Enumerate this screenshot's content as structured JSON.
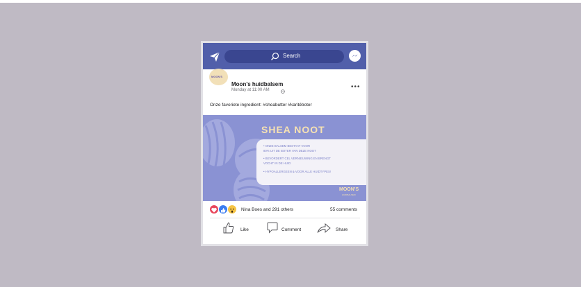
{
  "search": {
    "placeholder": "Search"
  },
  "post": {
    "avatar_text": "MOON'S",
    "page_name": "Moon's huidbalsem",
    "time": "Monday at 11:00 AM",
    "text": "Onze favoriete ingredient: #sheabutter #karitéboter",
    "image": {
      "headline": "SHEA NOOT",
      "bullets": [
        "• ONZE BALSEM BESTAAT VOOR",
        "  80% UIT DE BOTER VAN DEZE NOOT",
        "• BEVORDERT CEL VERNIEUWING EN BRENGT",
        "  VOCHT IN DE HUID",
        "• HYPOALLERGEEN & VOOR ALLE HUIDTYPES!"
      ],
      "brand": "MOON'S",
      "brand_sub": "HUIDBALSEM"
    }
  },
  "engagement": {
    "summary": "Nina Boes and  291 others",
    "comments": "55 comments"
  },
  "actions": {
    "like": "Like",
    "comment": "Comment",
    "share": "Share"
  },
  "icons": {
    "send": "send-icon",
    "search": "search-icon",
    "messenger": "messenger-icon",
    "more": "more-options-icon",
    "globe": "globe-icon",
    "reactions": [
      "love-reaction-icon",
      "like-reaction-icon",
      "wow-reaction-icon"
    ]
  },
  "colors": {
    "background": "#bfbac4",
    "topbar": "#515faa",
    "searchbar": "#3a4690",
    "image_bg": "#8a92d3",
    "headline": "#f7e2b2",
    "love": "#e8465b",
    "like": "#3b7cf0",
    "wow": "#f6c445"
  }
}
